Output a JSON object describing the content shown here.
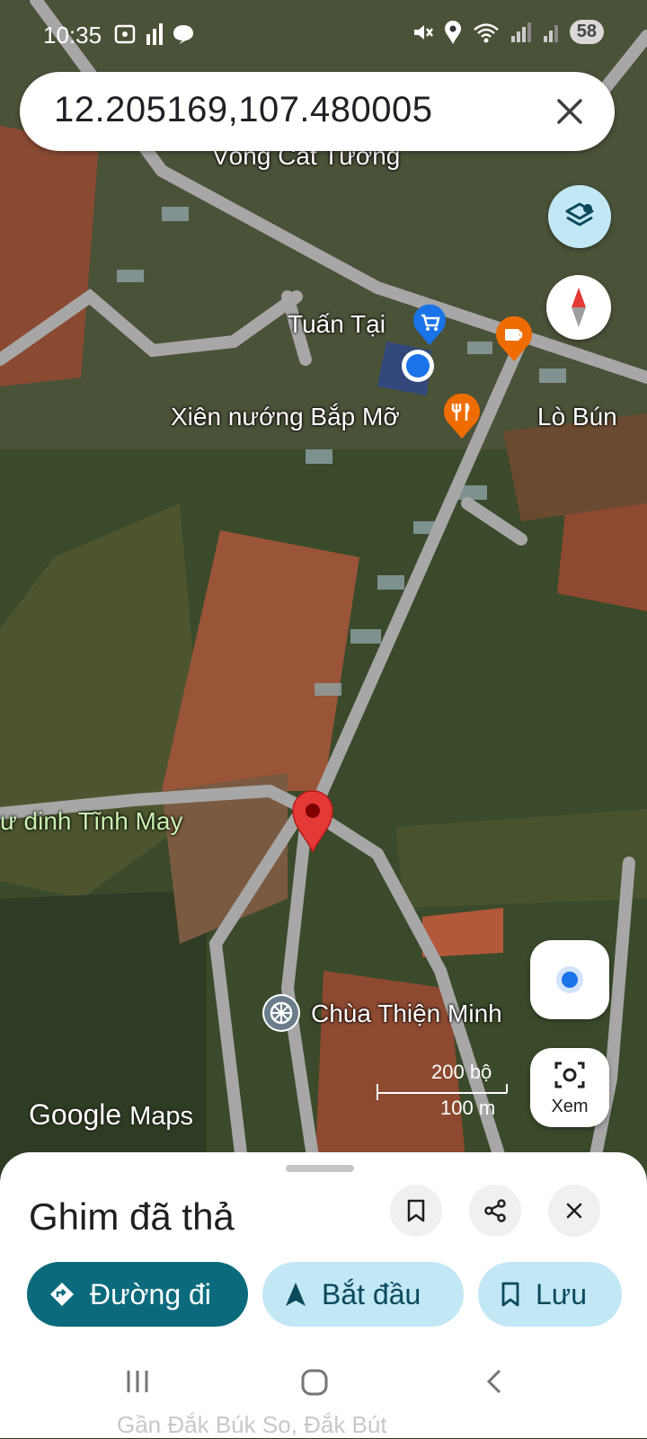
{
  "status_bar": {
    "time": "10:35",
    "battery": "58"
  },
  "search": {
    "query": "12.205169,107.480005"
  },
  "map": {
    "labels": {
      "top_road": "Vòng Cát Tường",
      "shop": "Tuấn Tại",
      "restaurant": "Xiên nướng Bắp Mỡ",
      "right": "Lò Bún",
      "left": "ư dinh Tĩnh May",
      "temple": "Chùa Thiện Minh"
    },
    "watermark": {
      "google": "Google",
      "maps": "Maps"
    },
    "scale": {
      "imperial": "200 bộ",
      "metric": "100 m"
    }
  },
  "controls": {
    "lens_label": "Xem"
  },
  "sheet": {
    "title": "Ghim đã thả",
    "directions_label": "Đường đi",
    "start_label": "Bắt đầu",
    "save_label": "Lưu",
    "peek_text": "Gần Đắk Búk So, Đắk Bút"
  },
  "colors": {
    "primary": "#0b6b7d",
    "chip": "#c2e7f5",
    "pin": "#e53935",
    "location": "#1a73e8"
  }
}
